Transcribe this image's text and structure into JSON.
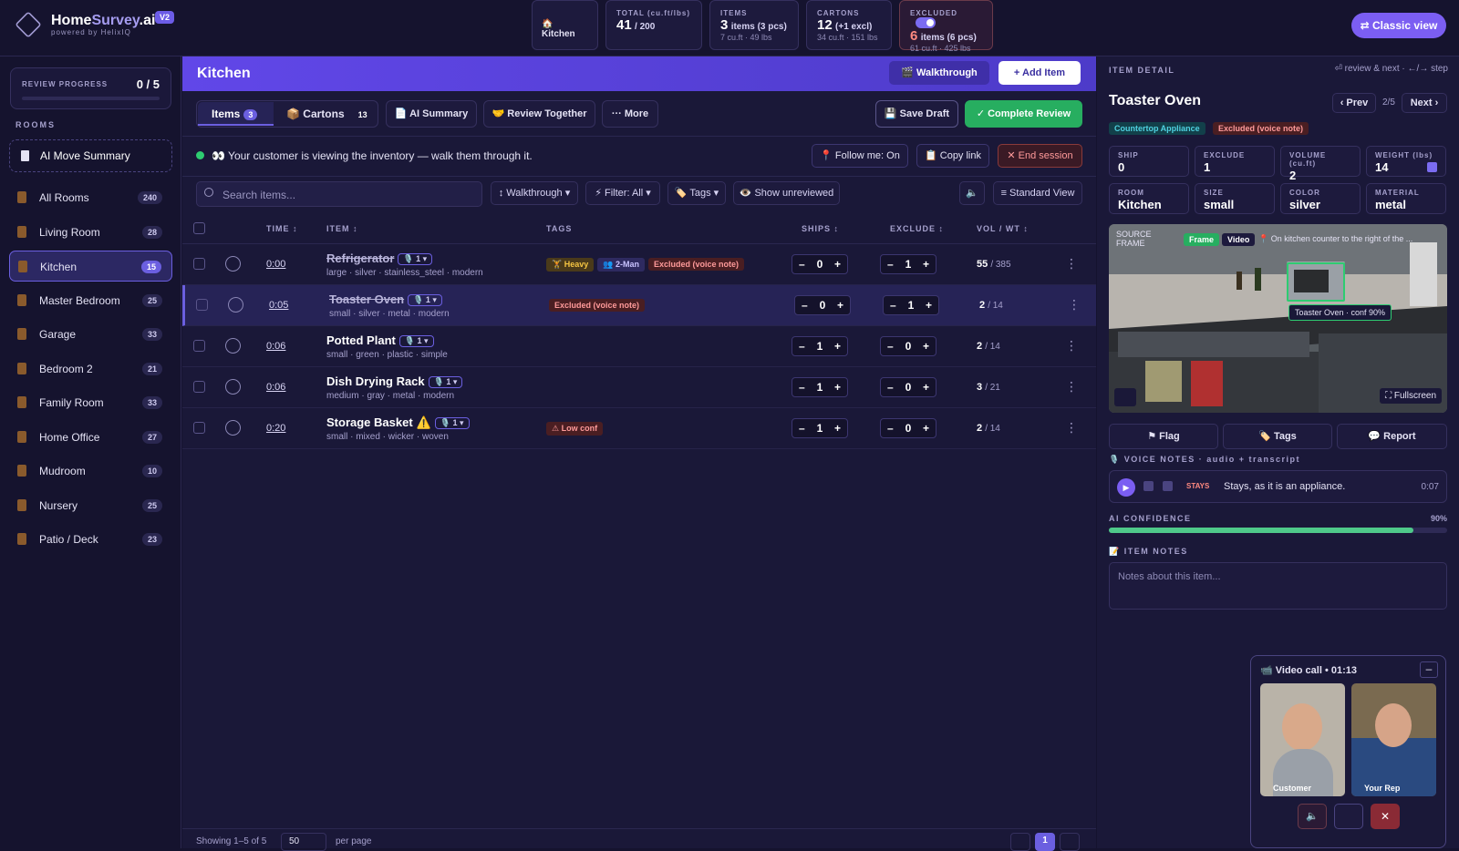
{
  "brand": {
    "name_a": "Home",
    "name_b": "Survey",
    "name_c": ".ai",
    "sub": "powered by HelixIQ",
    "version": "V2"
  },
  "stats": {
    "room": "🏠 Kitchen",
    "total": {
      "label": "TOTAL (cu.ft/lbs)",
      "value": "41",
      "of": "/ 200"
    },
    "items": {
      "label": "ITEMS",
      "value": "3",
      "unit": "items (3 pcs)",
      "sub": "7 cu.ft · 49 lbs"
    },
    "cartons": {
      "label": "CARTONS",
      "value": "12",
      "unit": "(+1 excl)",
      "sub": "34 cu.ft · 151 lbs"
    },
    "excluded": {
      "label": "EXCLUDED",
      "value": "6",
      "unit": "items (6 pcs)",
      "sub": "61 cu.ft · 425 lbs"
    }
  },
  "classic_view": "⇄ Classic view",
  "sidebar": {
    "review_label": "REVIEW PROGRESS",
    "review_value": "0 / 5",
    "review_progress": 0,
    "rooms_label": "ROOMS",
    "summary": "AI Move Summary",
    "rooms": [
      {
        "name": "All Rooms",
        "count": "240"
      },
      {
        "name": "Living Room",
        "count": "28"
      },
      {
        "name": "Kitchen",
        "count": "15"
      },
      {
        "name": "Master Bedroom",
        "count": "25"
      },
      {
        "name": "Garage",
        "count": "33"
      },
      {
        "name": "Bedroom 2",
        "count": "21"
      },
      {
        "name": "Family Room",
        "count": "33"
      },
      {
        "name": "Home Office",
        "count": "27"
      },
      {
        "name": "Mudroom",
        "count": "10"
      },
      {
        "name": "Nursery",
        "count": "25"
      },
      {
        "name": "Patio / Deck",
        "count": "23"
      }
    ]
  },
  "main": {
    "title": "Kitchen",
    "walkthrough": "🎬 Walkthrough",
    "add_item": "+ Add Item",
    "tabs": {
      "items": "Items",
      "items_count": "3",
      "cartons": "📦 Cartons",
      "cartons_count": "13"
    },
    "ai_summary": "📄 AI Summary",
    "review_together": "🤝 Review Together",
    "more": "··· More",
    "save_draft": "💾 Save Draft",
    "complete": "✓ Complete Review",
    "session_msg": "👀 Your customer is viewing the inventory — walk them through it.",
    "follow": "📍 Follow me: On",
    "copy": "📋 Copy link",
    "end": "✕ End session",
    "search_placeholder": "Search items...",
    "f_walk": "↕ Walkthrough ▾",
    "f_filter": "⚡ Filter: All ▾",
    "f_tags": "🏷️ Tags ▾",
    "f_unrev": "👁️ Show unreviewed",
    "f_std": "≡ Standard View",
    "cols": {
      "time": "TIME ↕",
      "item": "ITEM ↕",
      "tags": "TAGS",
      "ships": "SHIPS ↕",
      "exclude": "EXCLUDE ↕",
      "volwt": "VOL / WT ↕"
    },
    "rows": [
      {
        "time": "0:00",
        "name": "Refrigerator",
        "strike": true,
        "pill": "🎙️ 1 ▾",
        "desc": "large · silver · stainless_steel · modern",
        "tags": [
          "🏋️ Heavy",
          "👥 2-Man",
          "Excluded (voice note)"
        ],
        "ships": "0",
        "exclude": "1",
        "vol": "55",
        "wt": "/ 385"
      },
      {
        "time": "0:05",
        "name": "Toaster Oven",
        "strike": true,
        "pill": "🎙️ 1 ▾",
        "desc": "small · silver · metal · modern",
        "tags": [
          "Excluded (voice note)"
        ],
        "ships": "0",
        "exclude": "1",
        "vol": "2",
        "wt": "/ 14"
      },
      {
        "time": "0:06",
        "name": "Potted Plant",
        "strike": false,
        "pill": "🎙️ 1 ▾",
        "desc": "small · green · plastic · simple",
        "tags": [],
        "ships": "1",
        "exclude": "0",
        "vol": "2",
        "wt": "/ 14"
      },
      {
        "time": "0:06",
        "name": "Dish Drying Rack",
        "strike": false,
        "pill": "🎙️ 1 ▾",
        "desc": "medium · gray · metal · modern",
        "tags": [],
        "ships": "1",
        "exclude": "0",
        "vol": "3",
        "wt": "/ 21"
      },
      {
        "time": "0:20",
        "name": "Storage Basket",
        "strike": false,
        "warn": "⚠️",
        "pill": "🎙️ 1 ▾",
        "desc": "small · mixed · wicker · woven",
        "tags": [
          "⚠ Low conf"
        ],
        "ships": "1",
        "exclude": "0",
        "vol": "2",
        "wt": "/ 14"
      }
    ],
    "pager": {
      "showing": "Showing 1–5 of 5",
      "per_page_value": "50",
      "per_page": "per page",
      "page": "1"
    }
  },
  "detail": {
    "label": "ITEM DETAIL",
    "hint": "⏎ review & next · ←/→ step",
    "name": "Toaster Oven",
    "prev": "‹ Prev",
    "pos": "2/5",
    "next": "Next ›",
    "category": "Countertop Appliance",
    "status": "Excluded (voice note)",
    "fields": [
      {
        "k": "SHIP",
        "v": "0"
      },
      {
        "k": "EXCLUDE",
        "v": "1"
      },
      {
        "k": "VOLUME (cu.ft)",
        "v": "2"
      },
      {
        "k": "WEIGHT (lbs)",
        "v": "14"
      },
      {
        "k": "ROOM",
        "v": "Kitchen"
      },
      {
        "k": "SIZE",
        "v": "small"
      },
      {
        "k": "COLOR",
        "v": "silver"
      },
      {
        "k": "MATERIAL",
        "v": "metal"
      }
    ],
    "source_label": "SOURCE FRAME",
    "frame_tab": "Frame",
    "video_tab": "Video",
    "location": "📍 On kitchen counter to the right of the ...",
    "detect_label": "Toaster Oven · conf 90%",
    "fullscreen": "⛶ Fullscreen",
    "flag": "⚑ Flag",
    "tags": "🏷️ Tags",
    "report": "💬 Report",
    "voice_label": "🎙️ VOICE NOTES · audio + transcript",
    "voice_badge": "STAYS",
    "voice_text": "Stays, as it is an appliance.",
    "voice_time": "0:07",
    "conf_label": "AI CONFIDENCE",
    "conf_value": "90%",
    "conf": 0.9,
    "notes_label": "📝 ITEM NOTES",
    "notes_placeholder": "Notes about this item..."
  },
  "call": {
    "title": "📹 Video call • 01:13",
    "customer": "Customer",
    "rep": "Your Rep"
  },
  "colors": {
    "accent": "#6b5fe0",
    "success": "#27ae60",
    "danger": "#e74c3c"
  }
}
